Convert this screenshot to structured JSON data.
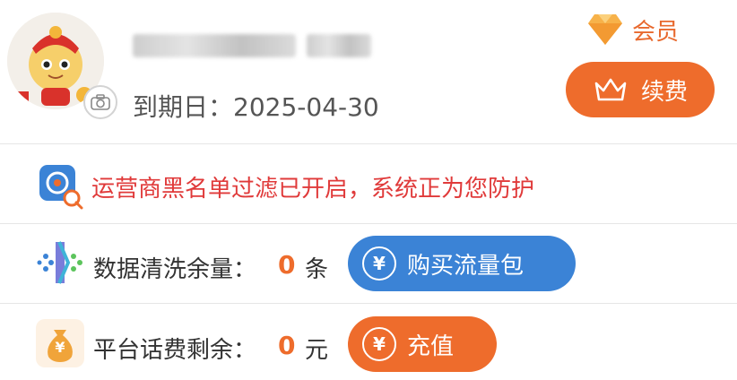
{
  "profile": {
    "expiry_label": "到期日：",
    "expiry_date": "2025-04-30",
    "member_label": "会员",
    "renew_label": "续费"
  },
  "notice": {
    "text": "运营商黑名单过滤已开启，系统正为您防护"
  },
  "data_cleaning": {
    "label": "数据清洗余量：",
    "value": "0",
    "unit": "条",
    "button_label": "购买流量包",
    "button_icon": "¥"
  },
  "balance": {
    "label": "平台话费剩余：",
    "value": "0",
    "unit": "元",
    "button_label": "充值",
    "button_icon": "¥",
    "bag_glyph": "¥"
  },
  "colors": {
    "accent": "#ee6c2c",
    "blue": "#3b83d6",
    "notice_red": "#e03a3a"
  }
}
